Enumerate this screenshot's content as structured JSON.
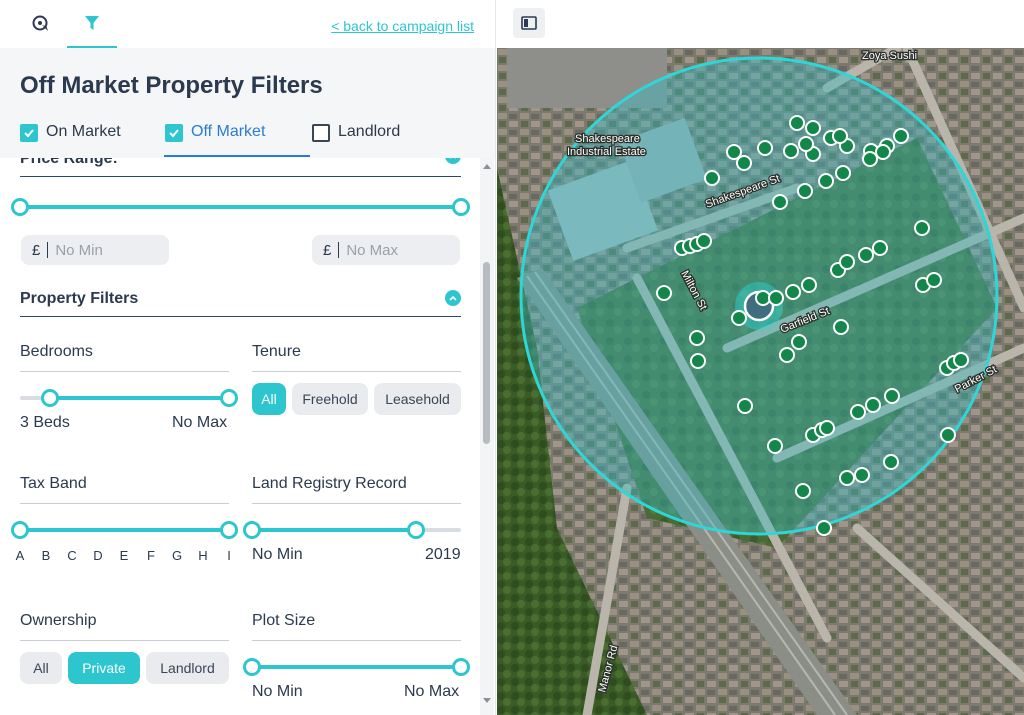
{
  "topbar": {
    "tabs": [
      {
        "icon": "radius-icon"
      },
      {
        "icon": "filter-icon"
      }
    ],
    "back_link": "< back to campaign list"
  },
  "header": {
    "title": "Off Market Property Filters",
    "market_tabs": [
      {
        "label": "On Market",
        "checked": true
      },
      {
        "label": "Off Market",
        "checked": true,
        "active": true
      },
      {
        "label": "Landlord",
        "checked": false
      }
    ]
  },
  "price_range": {
    "heading": "Price Range:",
    "min": {
      "currency": "£",
      "placeholder": "No Min"
    },
    "max": {
      "currency": "£",
      "placeholder": "No Max"
    }
  },
  "property_filters": {
    "heading": "Property Filters",
    "bedrooms": {
      "label": "Bedrooms",
      "min_label": "3 Beds",
      "max_label": "No Max"
    },
    "tenure": {
      "label": "Tenure",
      "options": [
        "All",
        "Freehold",
        "Leasehold"
      ],
      "selected": "All"
    },
    "tax_band": {
      "label": "Tax Band",
      "bands": [
        "A",
        "B",
        "C",
        "D",
        "E",
        "F",
        "G",
        "H",
        "I"
      ]
    },
    "land_registry": {
      "label": "Land Registry Record",
      "min_label": "No Min",
      "max_label": "2019"
    },
    "ownership": {
      "label": "Ownership",
      "options": [
        "All",
        "Private",
        "Landlord"
      ],
      "selected": "Private"
    },
    "plot_size": {
      "label": "Plot Size",
      "min_label": "No Min",
      "max_label": "No Max"
    }
  },
  "map": {
    "street_labels": [
      "Zoya Sushi",
      "Shakespeare Industrial Estate",
      "Shakespeare St",
      "Milton St",
      "Garfield St",
      "Parker St",
      "Manor Rd"
    ],
    "colors": {
      "accent": "#2dc6cf",
      "marker": "#13864a",
      "circle_fill": "#39b9c4"
    }
  }
}
